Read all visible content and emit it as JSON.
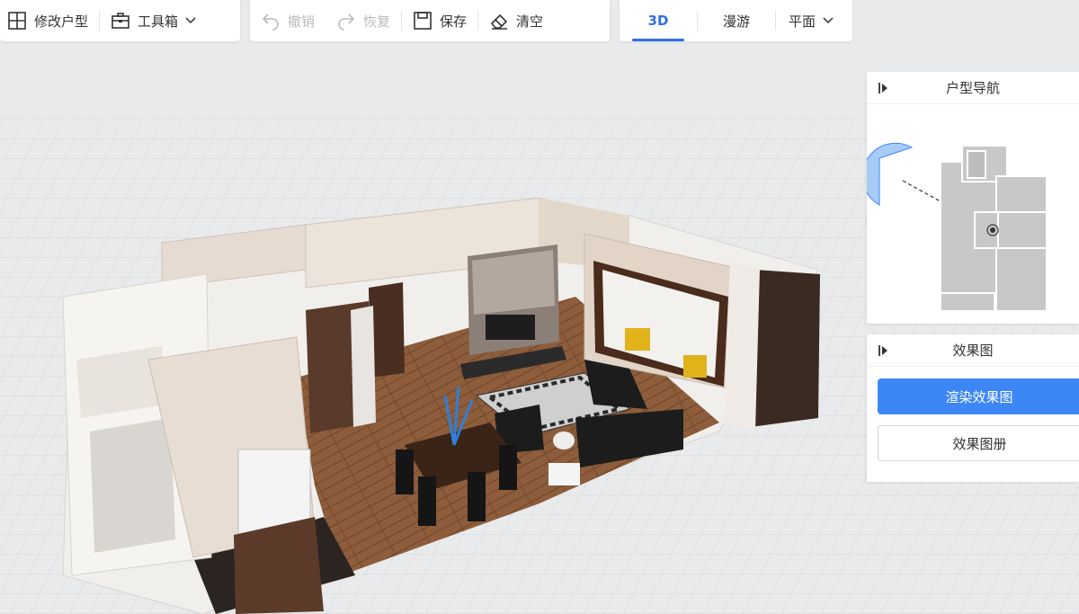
{
  "toolbar_left": {
    "modify_layout": "修改户型",
    "toolbox": "工具箱"
  },
  "toolbar_edit": {
    "undo": "撤销",
    "redo": "恢复",
    "save": "保存",
    "clear": "清空"
  },
  "view_tabs": {
    "tab_3d": "3D",
    "tab_roam": "漫游",
    "tab_plan": "平面"
  },
  "nav_panel": {
    "title": "户型导航"
  },
  "render_panel": {
    "title": "效果图",
    "render_button": "渲染效果图",
    "album_button": "效果图册"
  },
  "colors": {
    "accent": "#2f6fe4",
    "primary_button": "#3d86f5",
    "floor_wood": "#8a5a3a",
    "wall": "#e8ddd2"
  },
  "icons": {
    "modify_layout": "layout-grid-icon",
    "toolbox": "toolbox-icon",
    "undo": "undo-icon",
    "redo": "redo-icon",
    "save": "save-icon",
    "clear": "eraser-icon",
    "collapse": "collapse-panel-icon"
  }
}
